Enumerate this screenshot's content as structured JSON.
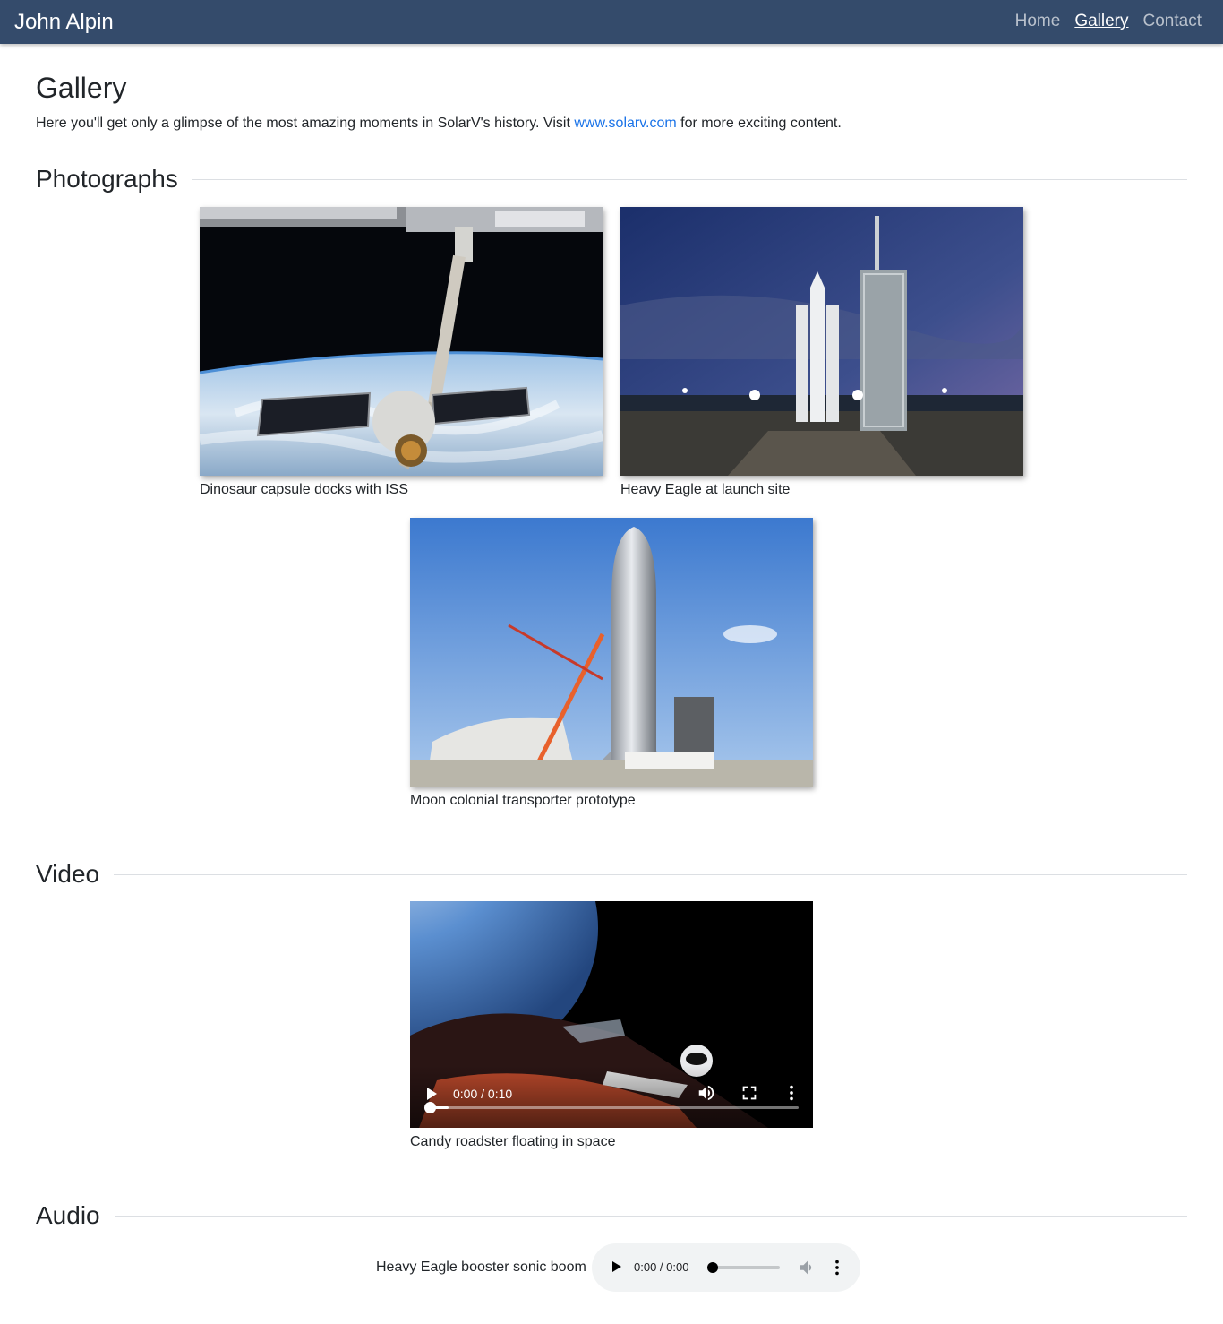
{
  "navbar": {
    "brand": "John Alpin",
    "links": [
      {
        "label": "Home",
        "active": false
      },
      {
        "label": "Gallery",
        "active": true
      },
      {
        "label": "Contact",
        "active": false
      }
    ]
  },
  "page": {
    "title": "Gallery",
    "intro_before": "Here you'll get only a glimpse of the most amazing moments in SolarV's history. Visit ",
    "intro_link": "www.solarv.com",
    "intro_after": " for more exciting content."
  },
  "sections": {
    "photographs": "Photographs",
    "video": "Video",
    "audio": "Audio"
  },
  "photos": [
    {
      "caption": "Dinosaur capsule docks with ISS"
    },
    {
      "caption": "Heavy Eagle at launch site"
    },
    {
      "caption": "Moon colonial transporter prototype"
    }
  ],
  "video": {
    "caption": "Candy roadster floating in space",
    "time": "0:00 / 0:10",
    "progress": 0.0
  },
  "audio": {
    "label": "Heavy Eagle booster sonic boom",
    "time": "0:00 / 0:00",
    "progress": 0.0
  },
  "colors": {
    "navbar": "#344b6b",
    "link": "#1a73e8"
  }
}
